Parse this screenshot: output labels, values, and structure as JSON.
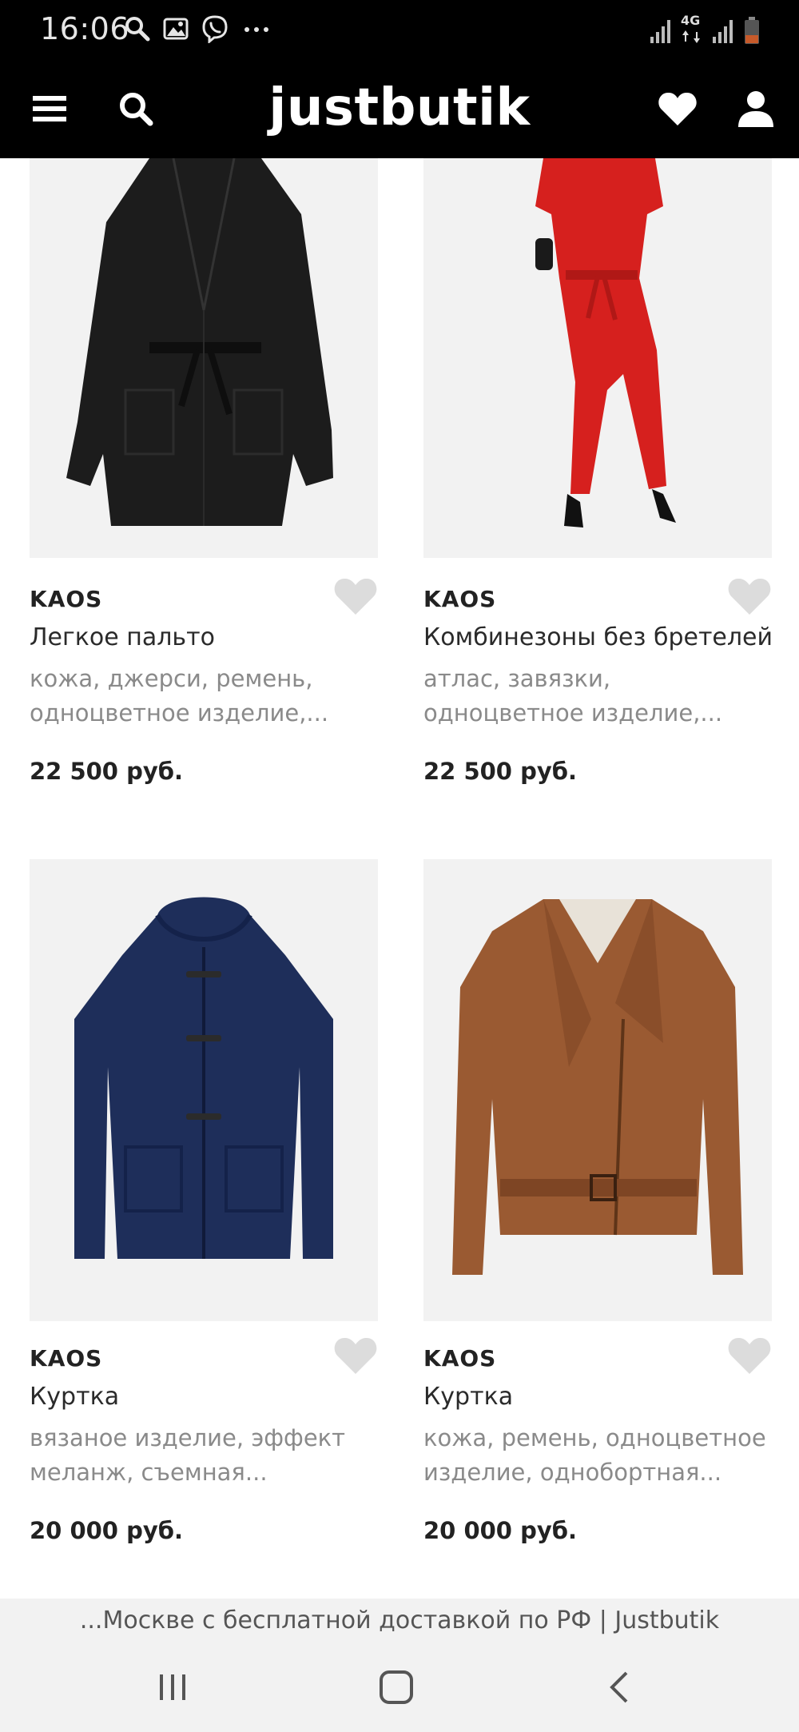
{
  "status_bar": {
    "time": "16:06",
    "left_icons": [
      "search-icon",
      "gallery-icon",
      "viber-icon",
      "more-dots-icon"
    ],
    "network_label": "4G",
    "right_icons": [
      "signal-icon",
      "network-4g-icon",
      "signal-icon",
      "battery-icon"
    ]
  },
  "header": {
    "logo": "justbutik",
    "icons": [
      "menu-icon",
      "search-icon",
      "heart-icon",
      "user-icon"
    ],
    "background": "#000000"
  },
  "products": [
    {
      "brand": "KAOS",
      "name": "Легкое пальто",
      "desc_line1": "кожа, джерси, ремень,",
      "desc_line2": "одноцветное изделие,...",
      "price": "22 500 руб.",
      "image": "black-coat"
    },
    {
      "brand": "KAOS",
      "name": "Комбинезоны без бретелей",
      "desc_line1": "атлас, завязки,",
      "desc_line2": "одноцветное изделие,...",
      "price": "22 500 руб.",
      "image": "red-jumpsuit"
    },
    {
      "brand": "KAOS",
      "name": "Куртка",
      "desc_line1": "вязаное изделие, эффект",
      "desc_line2": "меланж, съемная...",
      "price": "20 000 руб.",
      "image": "navy-knit-jacket"
    },
    {
      "brand": "KAOS",
      "name": "Куртка",
      "desc_line1": "кожа, ремень, одноцветное",
      "desc_line2": "изделие, однобортная...",
      "price": "20 000 руб.",
      "image": "brown-leather-jacket"
    }
  ],
  "url_bar": {
    "text": "...Москве с бесплатной доставкой по РФ | Justbutik"
  },
  "nav_bar": {
    "buttons": [
      "recent-apps-icon",
      "home-icon",
      "back-icon"
    ]
  },
  "colors": {
    "header_bg": "#000000",
    "card_bg": "#f2f2f2",
    "fav_icon": "#dcdcdc",
    "muted_text": "#8a8a8a"
  }
}
